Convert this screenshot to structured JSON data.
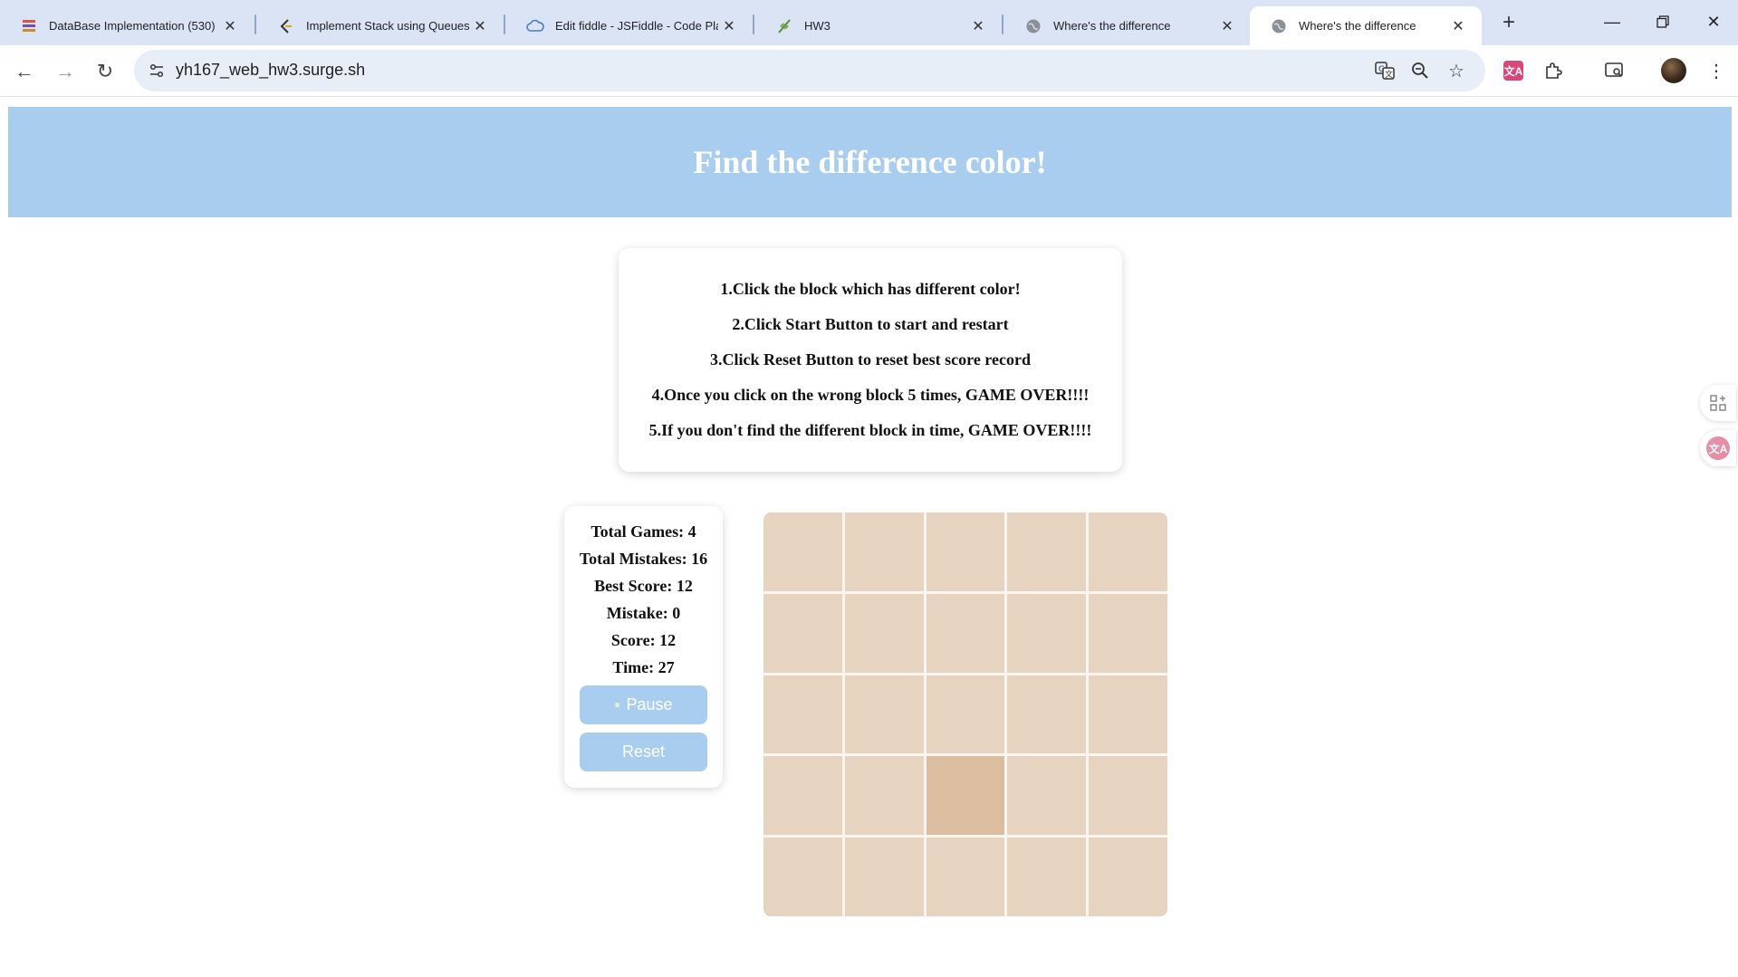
{
  "browser": {
    "tabs": [
      {
        "title": "DataBase Implementation (530)",
        "icon": "stack-icon"
      },
      {
        "title": "Implement Stack using Queues",
        "icon": "leetcode-icon"
      },
      {
        "title": "Edit fiddle - JSFiddle - Code Play",
        "icon": "cloud-icon"
      },
      {
        "title": "HW3",
        "icon": "plant-icon"
      },
      {
        "title": "Where's the difference",
        "icon": "globe-icon"
      },
      {
        "title": "Where's the difference",
        "icon": "globe-icon"
      }
    ],
    "active_tab_index": 5,
    "url": "yh167_web_hw3.surge.sh"
  },
  "page": {
    "title": "Find the difference color!",
    "rules": [
      "1.Click the block which has different color!",
      "2.Click Start Button to start and restart",
      "3.Click Reset Button to reset best score record",
      "4.Once you click on the wrong block 5 times, GAME OVER!!!!",
      "5.If you don't find the different block in time, GAME OVER!!!!"
    ],
    "stats": {
      "total_games": "Total Games: 4",
      "total_mistakes": "Total Mistakes: 16",
      "best_score": "Best Score: 12",
      "mistake": "Mistake: 0",
      "score": "Score: 12",
      "time": "Time: 27"
    },
    "buttons": {
      "pause_icon": "⏸",
      "pause_label": "Pause",
      "reset_label": "Reset"
    },
    "grid": {
      "rows": 5,
      "cols": 5,
      "base_color": "#e7d4c0",
      "odd_color": "#dbbd9f",
      "odd_cell": {
        "row": 3,
        "col": 2
      }
    }
  }
}
